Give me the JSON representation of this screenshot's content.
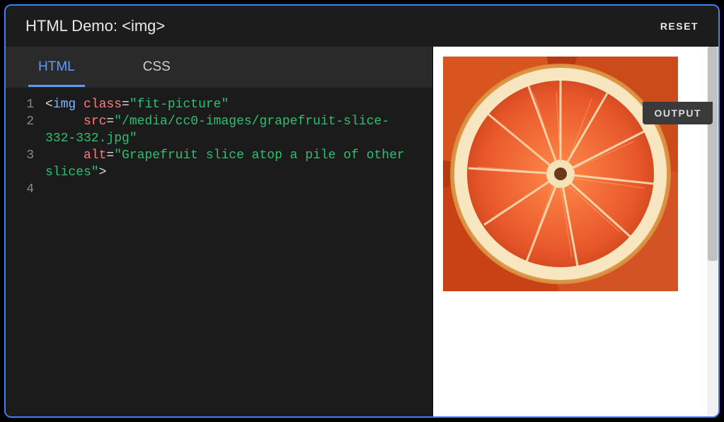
{
  "header": {
    "title": "HTML Demo: <img>",
    "reset_label": "RESET"
  },
  "tabs": {
    "html": "HTML",
    "css": "CSS"
  },
  "gutter": {
    "l1": "1",
    "l2": "2",
    "l3": "3",
    "l4": "4"
  },
  "code": {
    "line1": {
      "open": "<",
      "tag": "img",
      "sp": " ",
      "attr": "class",
      "eq": "=",
      "val": "\"fit-picture\""
    },
    "line2": {
      "indent": "     ",
      "attr": "src",
      "eq": "=",
      "val_a": "\"/media/cc0-images/grapefruit-slice-",
      "val_b": "332-332.jpg\""
    },
    "line3": {
      "indent": "     ",
      "attr": "alt",
      "eq": "=",
      "val_a": "\"Grapefruit slice atop a pile of other ",
      "val_b": "slices\"",
      "close": ">"
    }
  },
  "output": {
    "badge": "OUTPUT",
    "image_alt": "Grapefruit slice atop a pile of other slices"
  }
}
